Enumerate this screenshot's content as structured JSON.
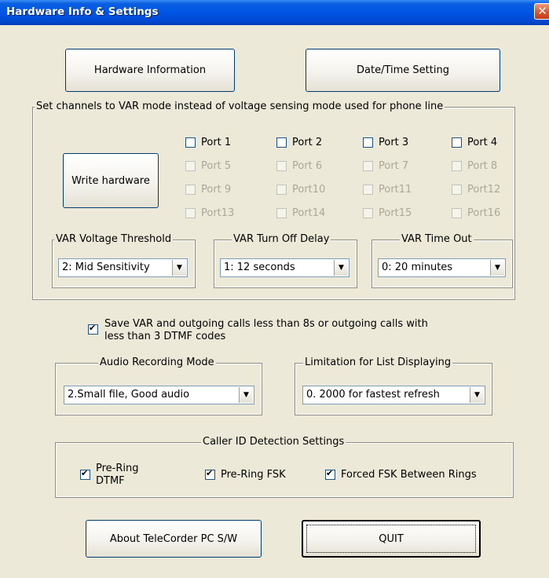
{
  "window": {
    "title": "Hardware Info & Settings",
    "close_glyph": "✕"
  },
  "buttons": {
    "hardware_info": "Hardware Information",
    "datetime": "Date/Time Setting",
    "write_hardware": "Write hardware",
    "about": "About TeleCorder PC S/W",
    "quit": "QUIT"
  },
  "var_group": {
    "legend": "Set channels to VAR mode instead of voltage sensing mode used for phone line",
    "ports": [
      {
        "label": "Port 1",
        "enabled": true
      },
      {
        "label": "Port 2",
        "enabled": true
      },
      {
        "label": "Port 3",
        "enabled": true
      },
      {
        "label": "Port 4",
        "enabled": true
      },
      {
        "label": "Port 5",
        "enabled": false
      },
      {
        "label": "Port 6",
        "enabled": false
      },
      {
        "label": "Port 7",
        "enabled": false
      },
      {
        "label": "Port 8",
        "enabled": false
      },
      {
        "label": "Port 9",
        "enabled": false
      },
      {
        "label": "Port10",
        "enabled": false
      },
      {
        "label": "Port11",
        "enabled": false
      },
      {
        "label": "Port12",
        "enabled": false
      },
      {
        "label": "Port13",
        "enabled": false
      },
      {
        "label": "Port14",
        "enabled": false
      },
      {
        "label": "Port15",
        "enabled": false
      },
      {
        "label": "Port16",
        "enabled": false
      }
    ],
    "threshold": {
      "legend": "VAR Voltage Threshold",
      "value": "2: Mid Sensitivity"
    },
    "turn_off_delay": {
      "legend": "VAR Turn Off Delay",
      "value": "1: 12 seconds"
    },
    "time_out": {
      "legend": "VAR Time Out",
      "value": "0: 20 minutes"
    }
  },
  "save_var": {
    "checked": true,
    "line1": "Save VAR and outgoing calls less than 8s or outgoing calls with",
    "line2": "less than 3 DTMF codes"
  },
  "audio": {
    "legend": "Audio Recording Mode",
    "value": "2.Small file, Good audio"
  },
  "limitation": {
    "legend": "Limitation for List Displaying",
    "value": "0. 2000 for fastest refresh"
  },
  "caller_id": {
    "legend": "Caller ID Detection Settings",
    "pre_ring_dtmf_line1": "Pre-Ring",
    "pre_ring_dtmf_line2": "DTMF",
    "pre_ring_fsk": "Pre-Ring FSK",
    "forced_fsk": "Forced FSK Between Rings"
  },
  "icons": {
    "dropdown_arrow": "▼"
  }
}
